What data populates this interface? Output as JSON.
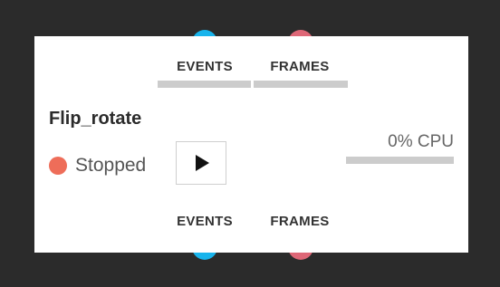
{
  "node": {
    "title": "Flip_rotate",
    "status_label": "Stopped",
    "status_color": "#ee6d59",
    "cpu_label": "0% CPU",
    "cpu_usage_fraction": 0.0
  },
  "inputs": {
    "events_label": "EVENTS",
    "frames_label": "FRAMES"
  },
  "outputs": {
    "events_label": "EVENTS",
    "frames_label": "FRAMES"
  },
  "colors": {
    "background": "#2b2b2b",
    "node_background": "#ffffff",
    "events_port": "#18b4ec",
    "frames_port": "#de6777",
    "bar": "#cccccc"
  },
  "icons": {
    "play": "play-icon"
  }
}
